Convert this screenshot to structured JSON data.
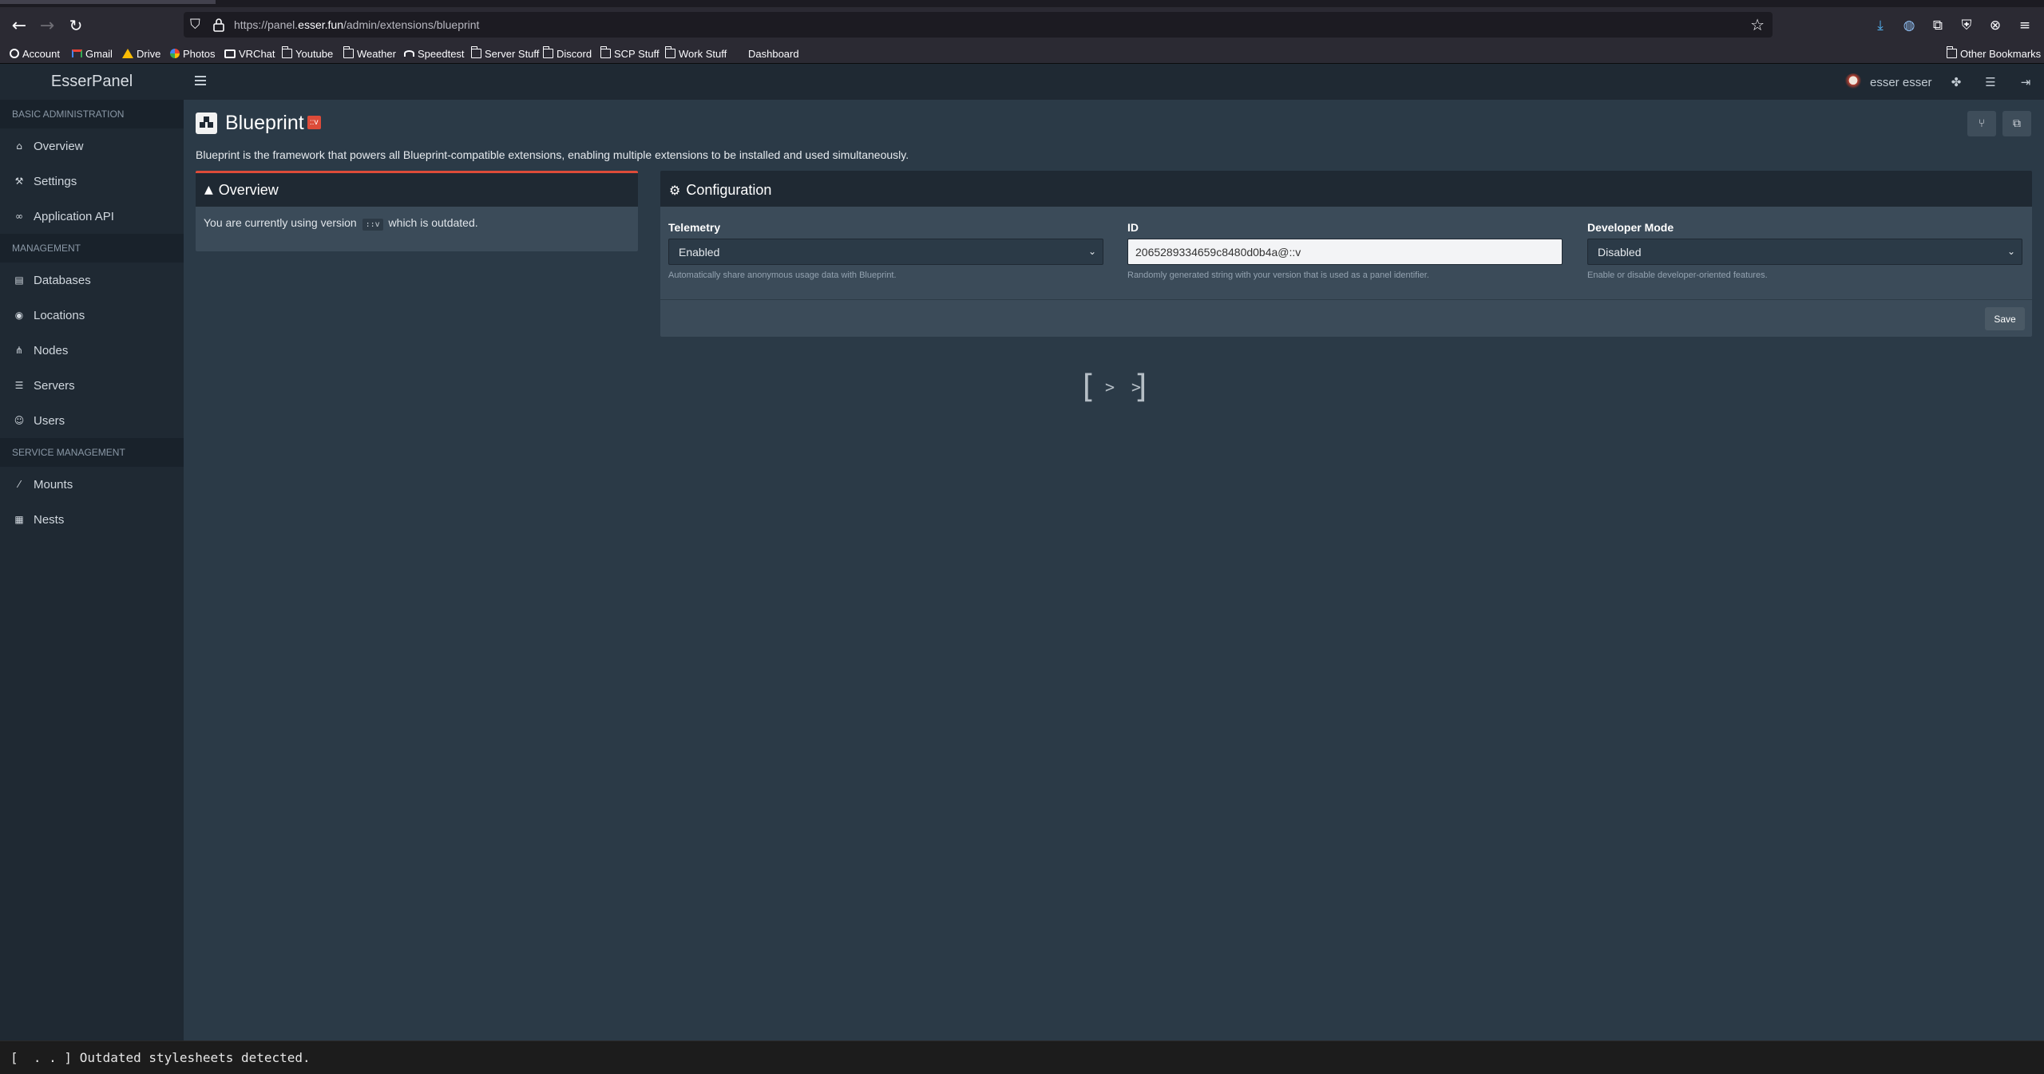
{
  "browser": {
    "url_prefix": "https://panel.",
    "url_domain": "esser.fun",
    "url_path": "/admin/extensions/blueprint",
    "bookmarks": [
      "Account",
      "Gmail",
      "Drive",
      "Photos",
      "VRChat",
      "Youtube",
      "Weather",
      "Speedtest",
      "Server Stuff",
      "Discord",
      "SCP Stuff",
      "Work Stuff",
      "Dashboard"
    ],
    "other_bookmarks": "Other Bookmarks"
  },
  "header": {
    "brand": "EsserPanel",
    "username": "esser esser"
  },
  "sidebar": {
    "sections": [
      {
        "title": "BASIC ADMINISTRATION",
        "items": [
          {
            "label": "Overview",
            "icon": "home-icon"
          },
          {
            "label": "Settings",
            "icon": "wrench-icon"
          },
          {
            "label": "Application API",
            "icon": "link-icon"
          }
        ]
      },
      {
        "title": "MANAGEMENT",
        "items": [
          {
            "label": "Databases",
            "icon": "database-icon"
          },
          {
            "label": "Locations",
            "icon": "globe-icon"
          },
          {
            "label": "Nodes",
            "icon": "sitemap-icon"
          },
          {
            "label": "Servers",
            "icon": "server-icon"
          },
          {
            "label": "Users",
            "icon": "users-icon"
          }
        ]
      },
      {
        "title": "SERVICE MANAGEMENT",
        "items": [
          {
            "label": "Mounts",
            "icon": "magic-icon"
          },
          {
            "label": "Nests",
            "icon": "grid-icon"
          }
        ]
      }
    ]
  },
  "page": {
    "title": "Blueprint",
    "version_badge": "::v",
    "description": "Blueprint is the framework that powers all Blueprint-compatible extensions, enabling multiple extensions to be installed and used simultaneously."
  },
  "overview": {
    "title": "Overview",
    "text_before": "You are currently using version",
    "version": "::v",
    "text_after": "which is outdated."
  },
  "configuration": {
    "title": "Configuration",
    "telemetry": {
      "label": "Telemetry",
      "value": "Enabled",
      "help": "Automatically share anonymous usage data with Blueprint."
    },
    "id": {
      "label": "ID",
      "value": "2065289334659c8480d0b4a@::v",
      "help": "Randomly generated string with your version that is used as a panel identifier."
    },
    "developer_mode": {
      "label": "Developer Mode",
      "value": "Disabled",
      "help": "Enable or disable developer-oriented features."
    },
    "save_label": "Save"
  },
  "console": {
    "message": "[  . . ] Outdated stylesheets detected."
  },
  "colors": {
    "accent_red": "#dd4b39",
    "sidebar_bg": "#1f2933",
    "content_bg": "#2b3a47"
  }
}
